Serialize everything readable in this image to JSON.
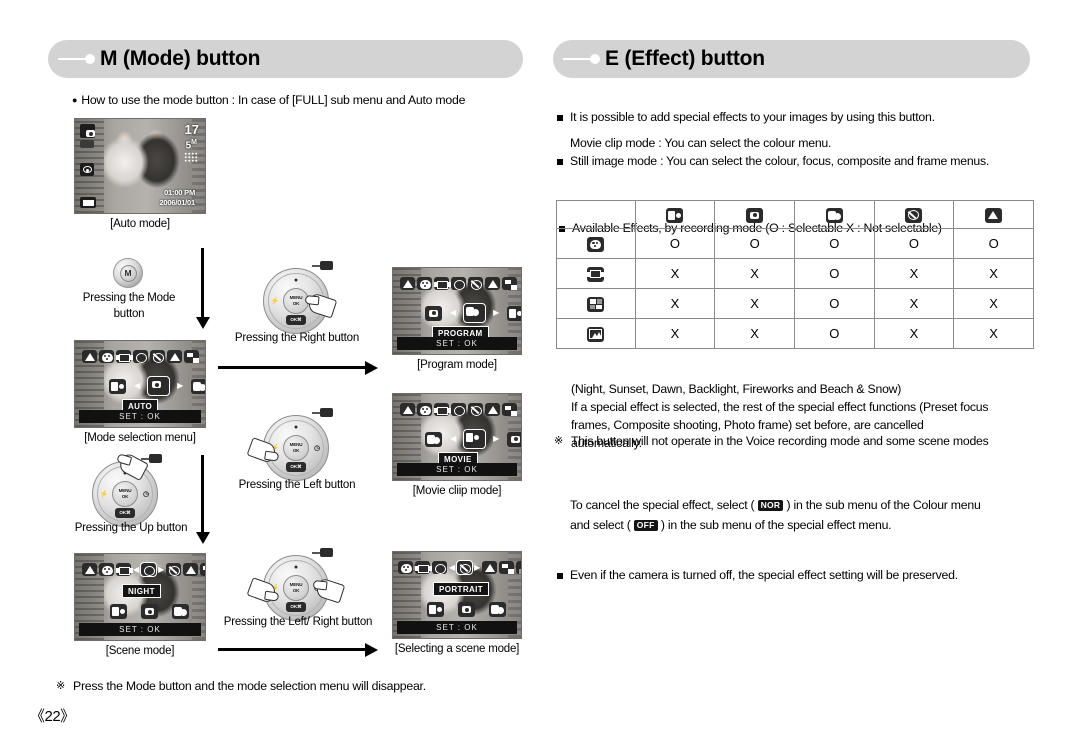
{
  "left": {
    "header": "M (Mode) button",
    "intro": "How to use the mode button : In case of [FULL] sub menu and Auto mode",
    "shots": {
      "auto": {
        "caption": "[Auto mode]",
        "osd_count": "17",
        "osd_size": "5",
        "osd_size_sup": "M",
        "osd_time": "01:00 PM",
        "osd_date": "2006/01/01"
      },
      "mode_menu": {
        "caption": "[Mode selection menu]",
        "label": "AUTO",
        "setok": "SET : OK"
      },
      "program": {
        "caption": "[Program mode]",
        "label": "PROGRAM",
        "setok": "SET : OK"
      },
      "movie": {
        "caption": "[Movie cliip mode]",
        "label": "MOVIE",
        "setok": "SET : OK"
      },
      "scene": {
        "caption": "[Scene mode]",
        "label": "NIGHT",
        "setok": "SET : OK"
      },
      "scene_sel": {
        "caption": "[Selecting a scene mode]",
        "label": "PORTRAIT",
        "setok": "SET : OK"
      }
    },
    "mode_button_glyph": "M",
    "steps": {
      "mode": "Pressing the Mode",
      "mode2": "button",
      "right": "Pressing the Right button",
      "left": "Pressing the Left button",
      "up": "Pressing the Up button",
      "leftright": "Pressing the Left/ Right button"
    },
    "pad_keys": {
      "ok_line1": "MENU",
      "ok_line2": "OK",
      "down": "OK⌘"
    },
    "footnote": "Press the Mode button and the mode selection menu will disappear.",
    "page_number": "《22》"
  },
  "right": {
    "header": "E (Effect) button",
    "bullets": [
      "It is possible to add special effects to your images by using this button.",
      "Still image mode : You can select the colour, focus, composite and frame menus.",
      "Movie clip mode : You can select the colour menu.",
      "Available Effects, by recording mode (O : Selectable X : Not selectable)"
    ],
    "table": {
      "column_icons": [
        "movie-clip-icon",
        "auto-mode-icon",
        "program-mode-icon",
        "night-scene-icon",
        "landscape-icon"
      ],
      "row_icons": [
        "colour-effect-icon",
        "preset-focus-frame-icon",
        "composite-shooting-icon",
        "photo-frame-icon"
      ],
      "rows": [
        [
          "O",
          "O",
          "O",
          "O",
          "O"
        ],
        [
          "X",
          "X",
          "O",
          "X",
          "X"
        ],
        [
          "X",
          "X",
          "O",
          "X",
          "X"
        ],
        [
          "X",
          "X",
          "O",
          "X",
          "X"
        ]
      ]
    },
    "note1": [
      "This button will not operate in the Voice recording mode and some scene modes",
      "(Night, Sunset, Dawn, Backlight, Fireworks and Beach & Snow)",
      "If a special effect is selected, the rest of the special effect functions (Preset focus",
      "frames, Composite shooting, Photo frame) set before, are cancelled",
      "automatically."
    ],
    "note2": {
      "line1": "Even if the camera is turned off, the special effect setting will be preserved.",
      "line2a": "To cancel the special effect, select (",
      "badge_nor": "NOR",
      "line2b": ") in the sub menu of the Colour menu",
      "line3a": "and select (",
      "badge_off": "OFF",
      "line3b": ") in the sub menu of the special effect menu."
    }
  },
  "colors": {
    "header_bg": "#d3d3d3",
    "header_accent": "#ffffff",
    "table_border": "#8a8a8a",
    "icon_dark": "#2b2b2b"
  }
}
